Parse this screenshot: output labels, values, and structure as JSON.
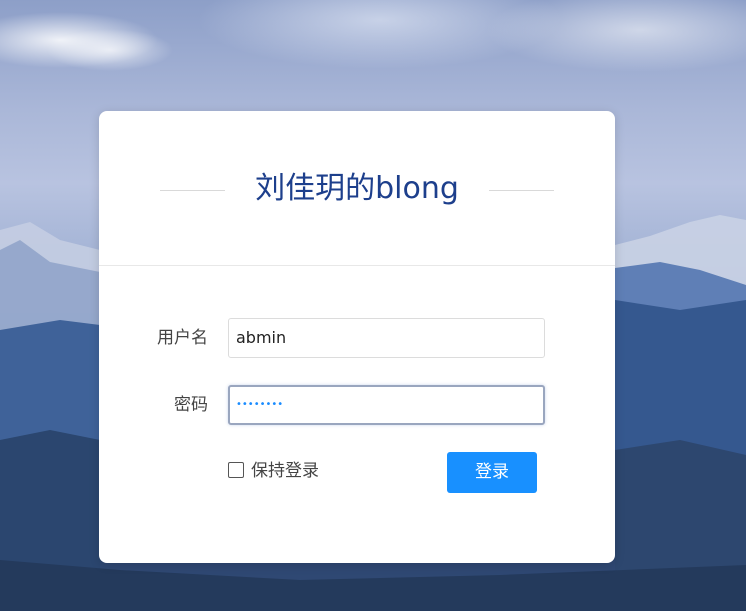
{
  "login": {
    "title": "刘佳玥的blong",
    "username_label": "用户名",
    "username_value": "abmin",
    "password_label": "密码",
    "password_masked": "••••••••",
    "remember_label": "保持登录",
    "remember_checked": false,
    "submit_label": "登录"
  },
  "colors": {
    "title": "#1d3f8c",
    "button": "#1890ff",
    "card": "#ffffff"
  }
}
